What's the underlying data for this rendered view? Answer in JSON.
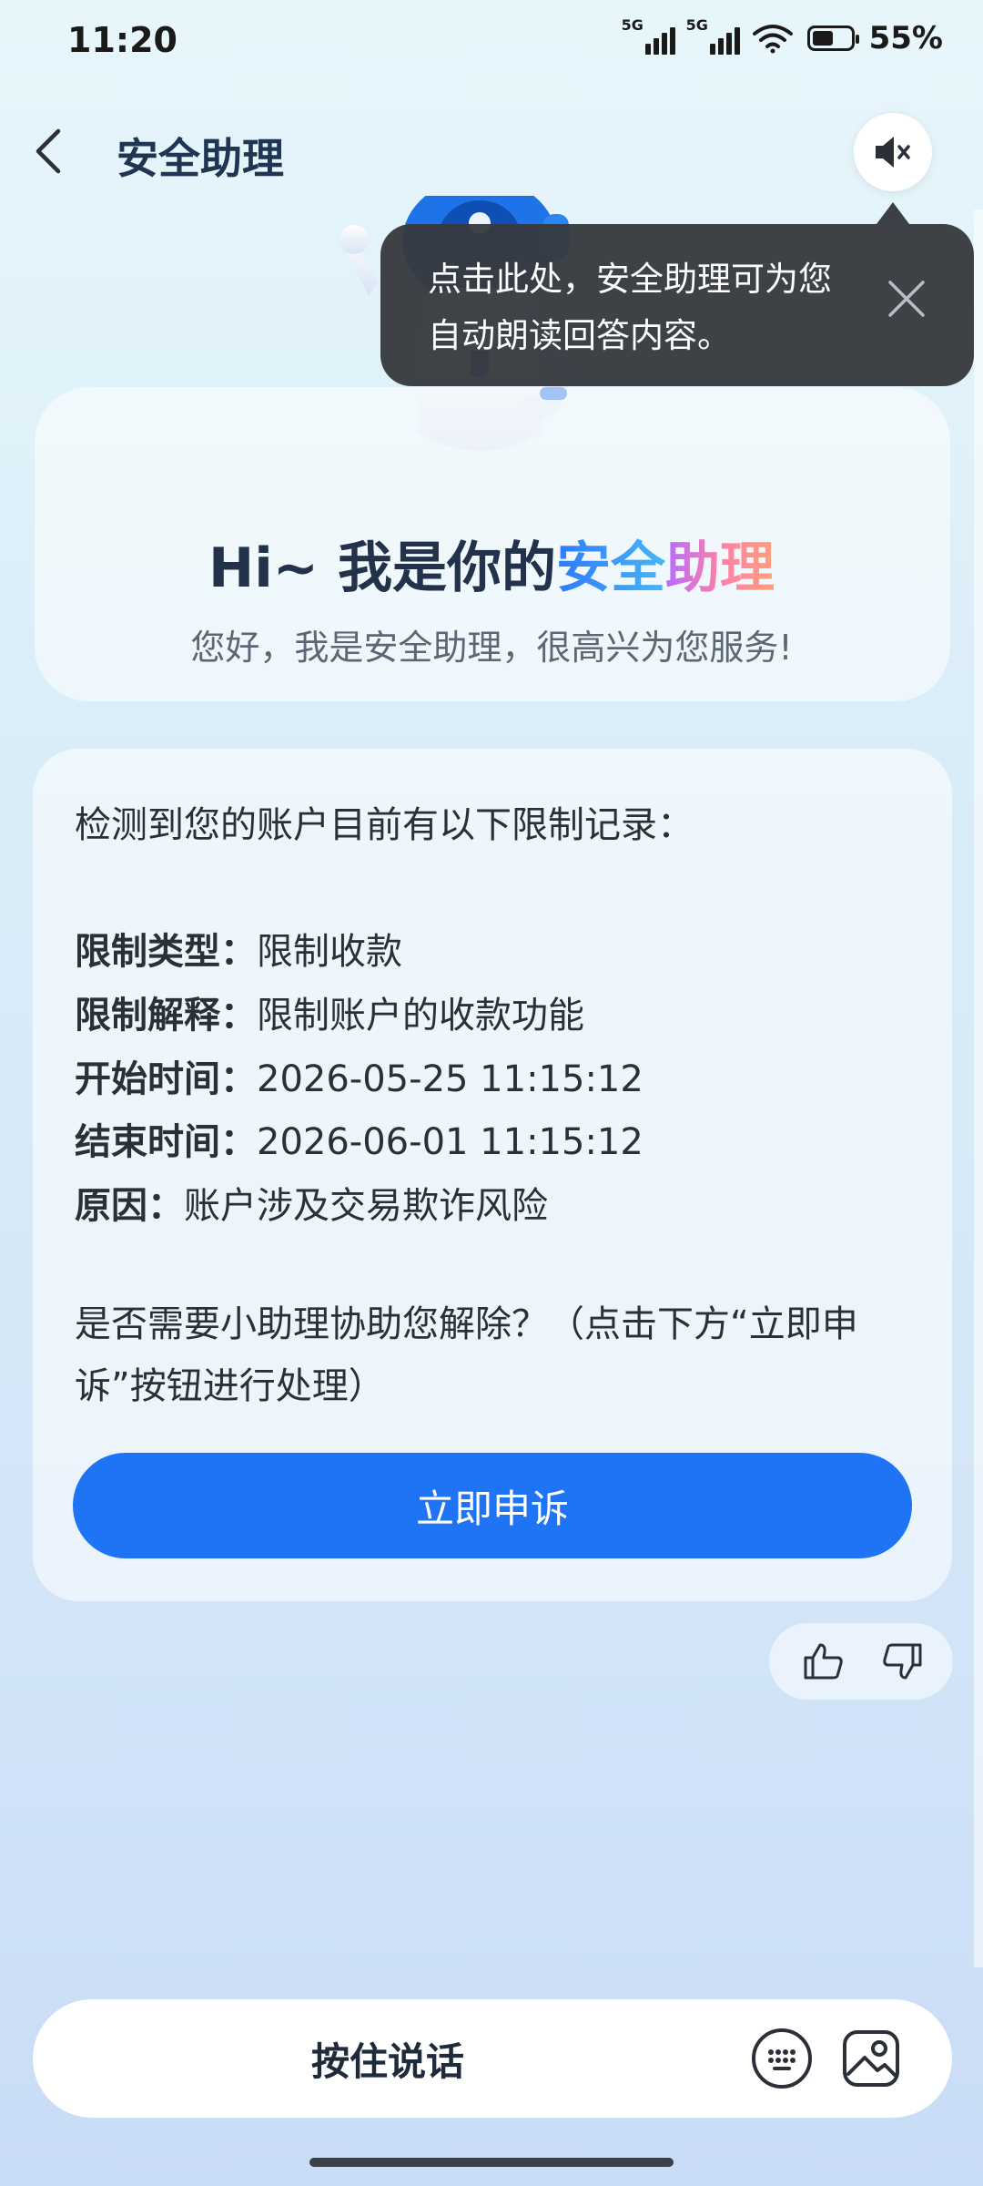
{
  "status_bar": {
    "time": "11:20",
    "signal_1_label": "5G",
    "signal_2_label": "5G",
    "battery_percent": 55,
    "battery_text": "55%"
  },
  "header": {
    "title": "安全助理",
    "back_icon": "chevron-left-icon",
    "mute_icon": "speaker-muted-icon"
  },
  "tooltip": {
    "text": "点击此处，安全助理可为您自动朗读回答内容。",
    "close_icon": "close-icon"
  },
  "greeting": {
    "title_prefix": "Hi~ 我是你的",
    "title_highlight_1": "安全",
    "title_highlight_2": "助理",
    "subtitle": "您好，我是安全助理，很高兴为您服务!"
  },
  "message": {
    "intro": "检测到您的账户目前有以下限制记录：",
    "fields": [
      {
        "label": "限制类型：",
        "value": "限制收款"
      },
      {
        "label": "限制解释：",
        "value": "限制账户的收款功能"
      },
      {
        "label": "开始时间：",
        "value": "2026-05-25 11:15:12"
      },
      {
        "label": "结束时间：",
        "value": "2026-06-01 11:15:12"
      },
      {
        "label": "原因：",
        "value": "账户涉及交易欺诈风险"
      }
    ],
    "question": "是否需要小助理协助您解除？（点击下方“立即申诉”按钮进行处理）",
    "appeal_button": "立即申诉"
  },
  "feedback": {
    "like_icon": "thumbs-up-icon",
    "dislike_icon": "thumbs-down-icon"
  },
  "input_bar": {
    "hold_to_talk": "按住说话",
    "keyboard_icon": "keyboard-icon",
    "image_icon": "image-icon"
  },
  "colors": {
    "accent": "#1e74f5",
    "tooltip_bg": "#3c3f45"
  }
}
